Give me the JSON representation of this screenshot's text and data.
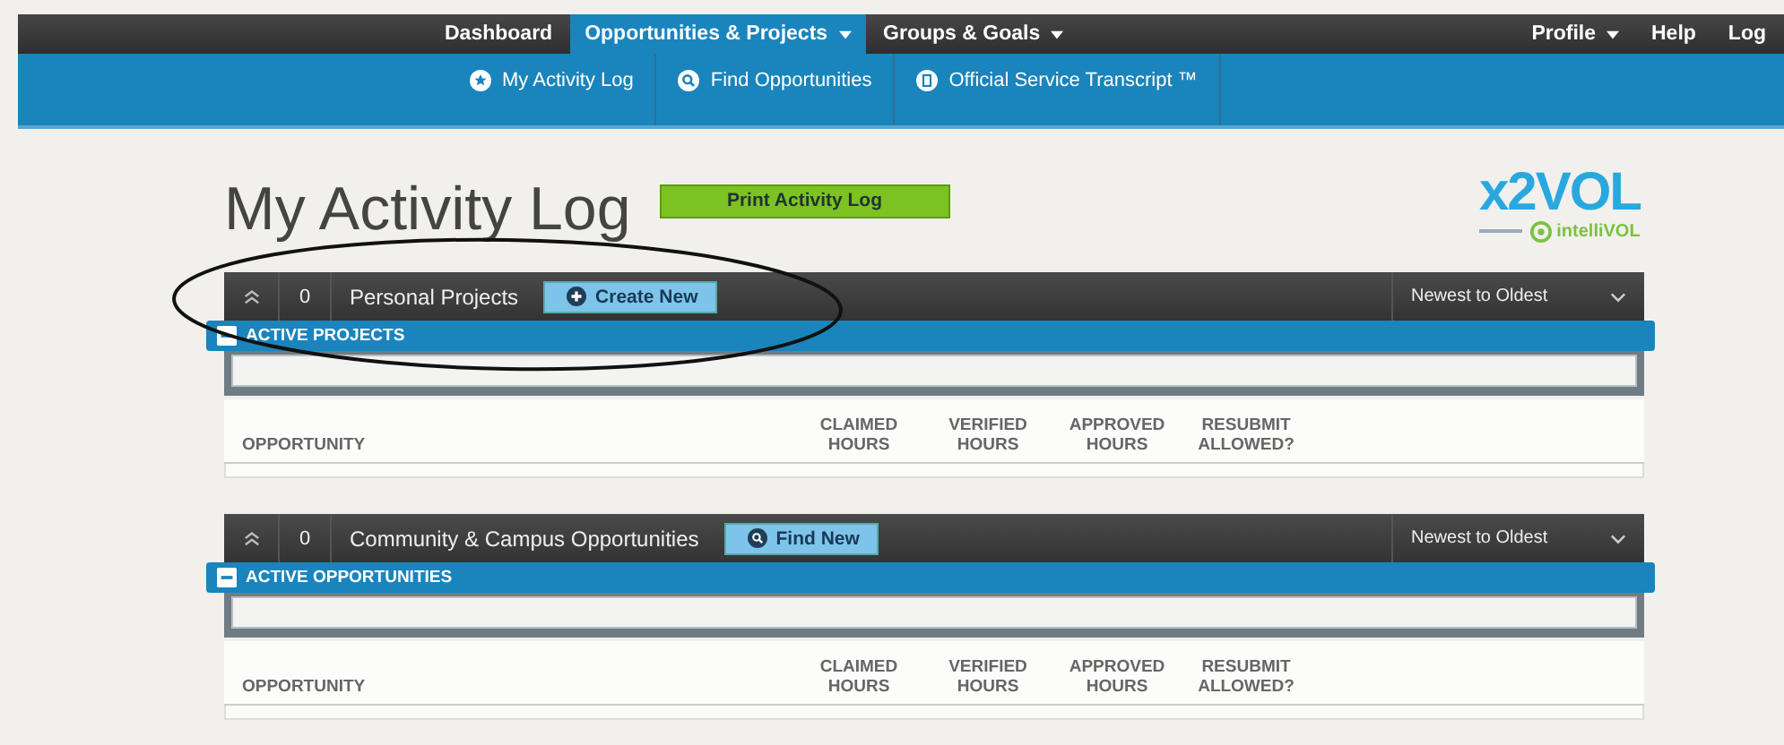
{
  "top_nav": {
    "items": [
      {
        "label": "Dashboard",
        "selected": false,
        "dropdown": false
      },
      {
        "label": "Opportunities & Projects",
        "selected": true,
        "dropdown": true
      },
      {
        "label": "Groups & Goals",
        "selected": false,
        "dropdown": true
      }
    ],
    "right_items": [
      {
        "label": "Profile",
        "dropdown": true
      },
      {
        "label": "Help",
        "dropdown": false
      },
      {
        "label": "Log",
        "dropdown": false
      }
    ]
  },
  "sub_nav": [
    {
      "label": "My Activity Log",
      "kind": "star"
    },
    {
      "label": "Find Opportunities",
      "kind": "search"
    },
    {
      "label": "Official Service Transcript ™",
      "kind": "doc"
    }
  ],
  "page_title": "My Activity Log",
  "print_button": "Print Activity Log",
  "logo": {
    "name": "x2VOL",
    "byline": "intelliVOL"
  },
  "sections": [
    {
      "count": "0",
      "title": "Personal Projects",
      "action": {
        "label": "Create New",
        "kind": "plus"
      },
      "sort": "Newest to Oldest",
      "group": "ACTIVE PROJECTS",
      "annotated": true,
      "columns": [
        "OPPORTUNITY",
        "CLAIMED HOURS",
        "VERIFIED HOURS",
        "APPROVED HOURS",
        "RESUBMIT ALLOWED?"
      ]
    },
    {
      "count": "0",
      "title": "Community & Campus Opportunities",
      "action": {
        "label": "Find New",
        "kind": "search"
      },
      "sort": "Newest to Oldest",
      "group": "ACTIVE OPPORTUNITIES",
      "annotated": false,
      "columns": [
        "OPPORTUNITY",
        "CLAIMED HOURS",
        "VERIFIED HOURS",
        "APPROVED HOURS",
        "RESUBMIT ALLOWED?"
      ]
    }
  ]
}
